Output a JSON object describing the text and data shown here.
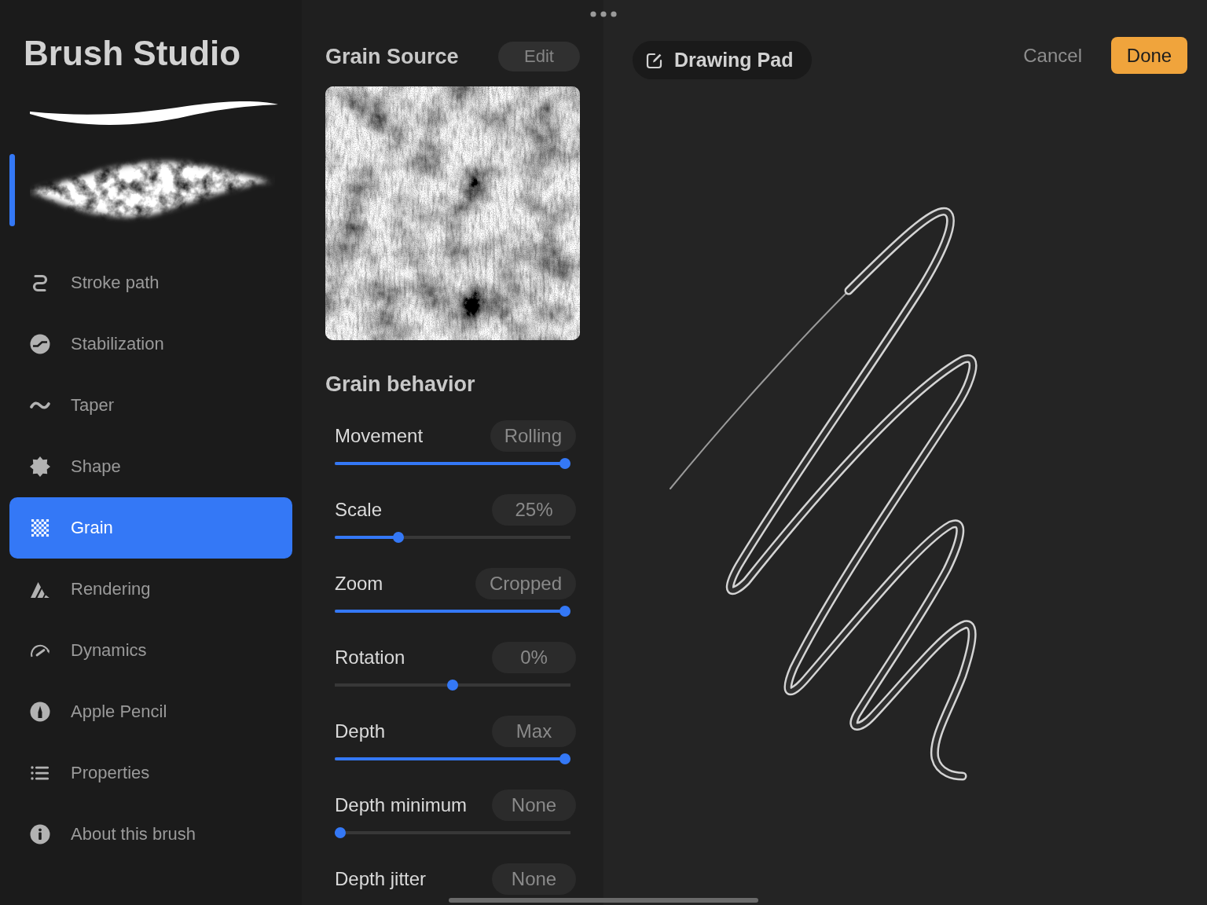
{
  "sidebar": {
    "title": "Brush Studio",
    "stroke_previews": [
      {
        "kind": "solid",
        "selected": false
      },
      {
        "kind": "grain",
        "selected": true
      }
    ],
    "items": [
      {
        "label": "Stroke path",
        "selected": false
      },
      {
        "label": "Stabilization",
        "selected": false
      },
      {
        "label": "Taper",
        "selected": false
      },
      {
        "label": "Shape",
        "selected": false
      },
      {
        "label": "Grain",
        "selected": true
      },
      {
        "label": "Rendering",
        "selected": false
      },
      {
        "label": "Dynamics",
        "selected": false
      },
      {
        "label": "Apple Pencil",
        "selected": false
      },
      {
        "label": "Properties",
        "selected": false
      },
      {
        "label": "About this brush",
        "selected": false
      }
    ]
  },
  "grain_panel": {
    "title": "Grain Source",
    "edit_button": "Edit",
    "behavior_title": "Grain behavior",
    "settings": [
      {
        "kind": "slider",
        "label": "Movement",
        "value": "Rolling",
        "level": 1
      },
      {
        "kind": "slider",
        "label": "Scale",
        "value": "25%",
        "level": 0.26
      },
      {
        "kind": "slider",
        "label": "Zoom",
        "value": "Cropped",
        "level": 1
      },
      {
        "kind": "centered_slider",
        "label": "Rotation",
        "value": "0%",
        "level": 0.5
      },
      {
        "kind": "slider",
        "label": "Depth",
        "value": "Max",
        "level": 1
      },
      {
        "kind": "slider",
        "label": "Depth minimum",
        "value": "None",
        "level": 0
      },
      {
        "kind": "slider",
        "label": "Depth jitter",
        "value": "None"
      }
    ]
  },
  "drawing_pad": {
    "title": "Drawing Pad",
    "cancel_button": "Cancel",
    "done_button": "Done"
  }
}
